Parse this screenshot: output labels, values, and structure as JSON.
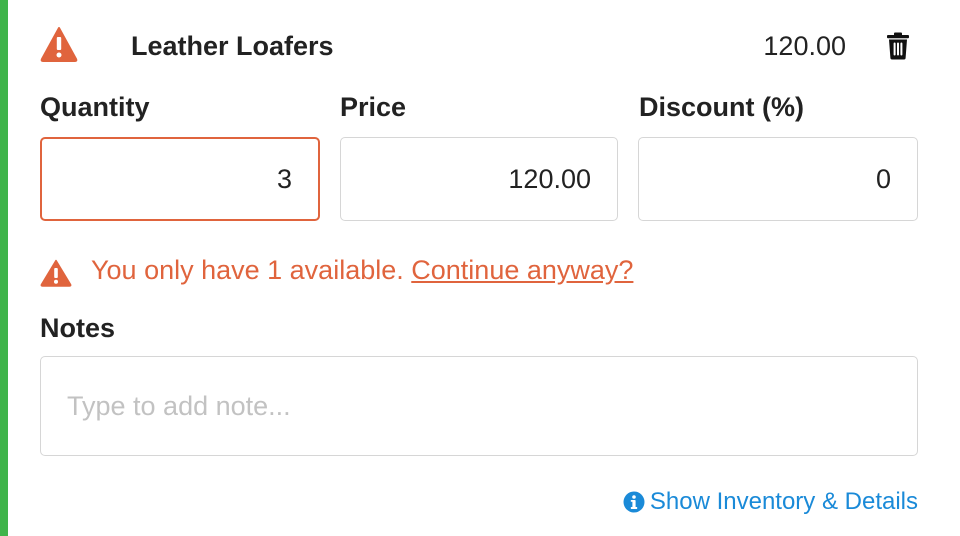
{
  "item": {
    "name": "Leather Loafers",
    "total": "120.00"
  },
  "fields": {
    "quantity": {
      "label": "Quantity",
      "value": "3"
    },
    "price": {
      "label": "Price",
      "value": "120.00"
    },
    "discount": {
      "label": "Discount (%)",
      "value": "0"
    }
  },
  "warning": {
    "message": "You only have 1 available.",
    "link": "Continue anyway?"
  },
  "notes": {
    "label": "Notes",
    "placeholder": "Type to add note..."
  },
  "footer": {
    "inventory_link": "Show Inventory & Details"
  },
  "colors": {
    "accent": "#3fb44a",
    "warning": "#e0643d",
    "link": "#1a8ad8"
  },
  "icons": {
    "header_status": "warning-triangle-icon",
    "delete": "trash-icon",
    "warning": "warning-triangle-icon",
    "info": "info-circle-icon"
  }
}
